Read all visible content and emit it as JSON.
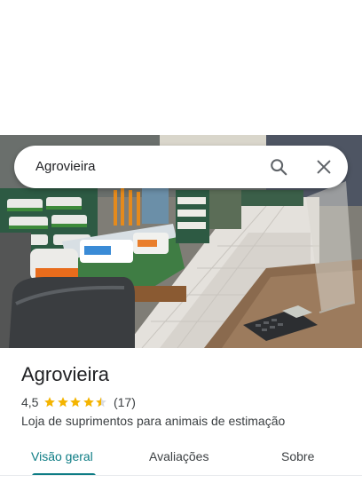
{
  "search": {
    "query": "Agrovieira",
    "search_icon": "search-icon",
    "close_icon": "close-icon"
  },
  "place": {
    "name": "Agrovieira",
    "rating": "4,5",
    "rating_value": 4.5,
    "review_count": "(17)",
    "category": "Loja de suprimentos para animais de estimação"
  },
  "tabs": [
    {
      "label": "Visão geral",
      "active": true
    },
    {
      "label": "Avaliações",
      "active": false
    },
    {
      "label": "Sobre",
      "active": false
    }
  ],
  "colors": {
    "accent": "#0d7c84",
    "star": "#f4b400"
  }
}
